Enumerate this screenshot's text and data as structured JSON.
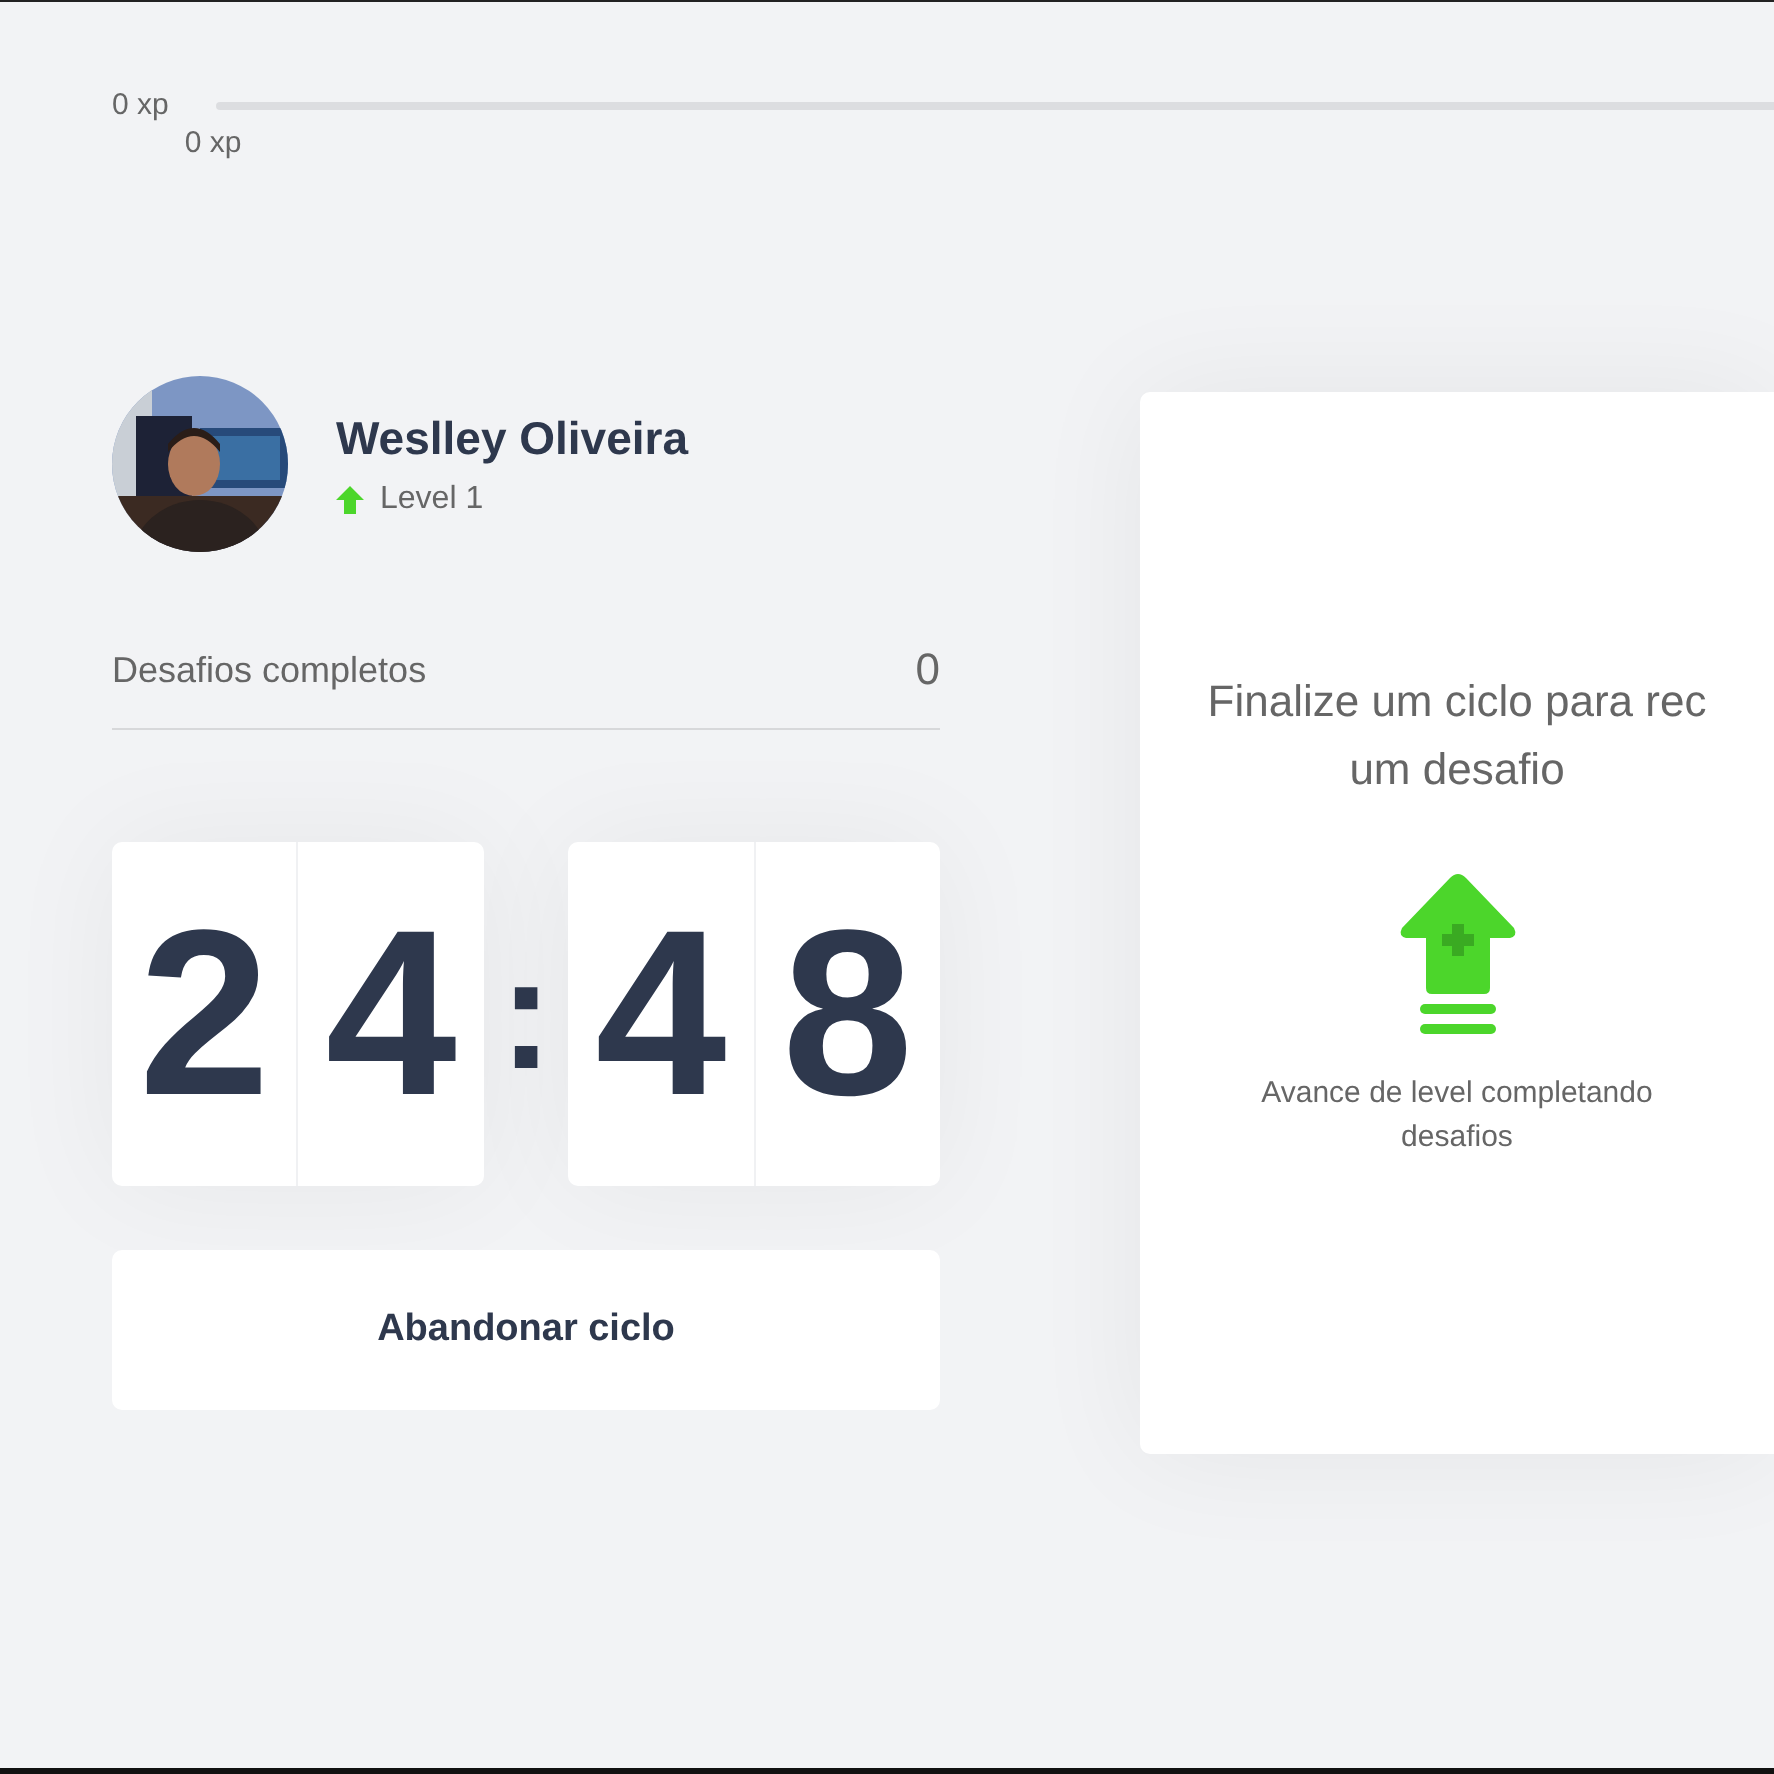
{
  "xp_bar": {
    "start_label": "0 xp",
    "current_label": "0 xp",
    "level": 0
  },
  "profile": {
    "name": "Weslley Oliveira",
    "level_label": "Level 1"
  },
  "challenges": {
    "label": "Desafios completos",
    "count": "0"
  },
  "countdown": {
    "minutes": [
      "2",
      "4"
    ],
    "separator": ":",
    "seconds": [
      "4",
      "8"
    ]
  },
  "cycle_button": {
    "label": "Abandonar ciclo"
  },
  "challenge_card": {
    "title": "Finalize um ciclo para rec\num desafio",
    "text": "Avance de level completando\ndesafios"
  }
}
